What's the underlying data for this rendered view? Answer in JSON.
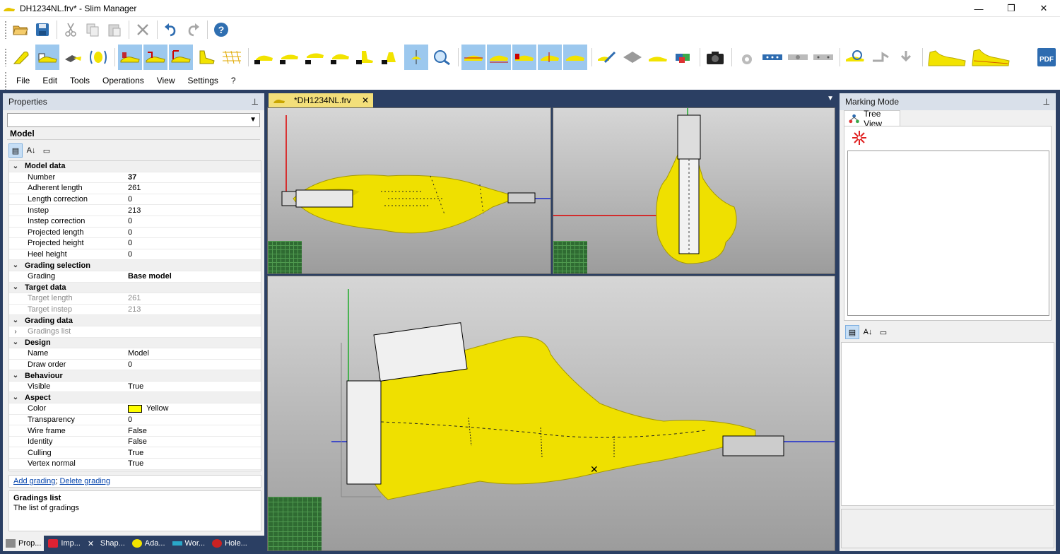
{
  "window": {
    "title": "DH1234NL.frv* - Slim Manager",
    "controls": [
      "—",
      "❐",
      "✕"
    ]
  },
  "menu": [
    "File",
    "Edit",
    "Tools",
    "Operations",
    "View",
    "Settings",
    "?"
  ],
  "properties": {
    "header": "Properties",
    "pin": "⊥",
    "object_name": "Model",
    "rows": [
      {
        "type": "cat",
        "label": "Model data"
      },
      {
        "label": "Number",
        "value": "37",
        "bold": true
      },
      {
        "label": "Adherent length",
        "value": "261"
      },
      {
        "label": "Length correction",
        "value": "0"
      },
      {
        "label": "Instep",
        "value": "213"
      },
      {
        "label": "Instep correction",
        "value": "0"
      },
      {
        "label": "Projected length",
        "value": "0"
      },
      {
        "label": "Projected height",
        "value": "0"
      },
      {
        "label": "Heel height",
        "value": "0"
      },
      {
        "type": "cat",
        "label": "Grading selection"
      },
      {
        "label": "Grading",
        "value": "Base model",
        "bold": true
      },
      {
        "type": "cat",
        "label": "Target data"
      },
      {
        "label": "Target length",
        "value": "261",
        "dim": true
      },
      {
        "label": "Target instep",
        "value": "213",
        "dim": true
      },
      {
        "type": "cat",
        "label": "Grading data"
      },
      {
        "label": "Gradings list",
        "value": "",
        "dim": true,
        "expandable": true
      },
      {
        "type": "cat",
        "label": "Design"
      },
      {
        "label": "Name",
        "value": "Model"
      },
      {
        "label": "Draw order",
        "value": "0"
      },
      {
        "type": "cat",
        "label": "Behaviour"
      },
      {
        "label": "Visible",
        "value": "True"
      },
      {
        "type": "cat",
        "label": "Aspect"
      },
      {
        "label": "Color",
        "value": "Yellow",
        "swatch": "#ffff00"
      },
      {
        "label": "Transparency",
        "value": "0"
      },
      {
        "label": "Wire frame",
        "value": "False"
      },
      {
        "label": "Identity",
        "value": "False"
      },
      {
        "label": "Culling",
        "value": "True"
      },
      {
        "label": "Vertex normal",
        "value": "True"
      }
    ],
    "link_add": "Add grading",
    "link_delete": "Delete grading",
    "link_sep": ";",
    "desc_title": "Gradings list",
    "desc_text": "The list of gradings"
  },
  "bottom_tabs": [
    "Prop...",
    "Imp...",
    "Shap...",
    "Ada...",
    "Wor...",
    "Hole..."
  ],
  "document": {
    "tab_label": "*DH1234NL.frv",
    "close": "✕",
    "menu": "▼"
  },
  "marking": {
    "header": "Marking Mode",
    "pin": "⊥",
    "tab": "Tree View"
  },
  "colors": {
    "accent": "#9cc8ee",
    "workspace": "#2b3f63",
    "shoe": "#f2e300",
    "tab": "#f3df7a"
  }
}
